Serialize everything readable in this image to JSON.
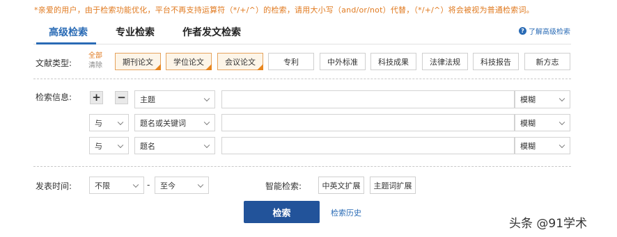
{
  "notice": "*亲爱的用户，由于检索功能优化，平台不再支持运算符（*/+/^）的检索，请用大小写（and/or/not）代替，（*/+/^）将会被视为普通检索词。",
  "tabs": [
    {
      "label": "高级检索",
      "active": true
    },
    {
      "label": "专业检索",
      "active": false
    },
    {
      "label": "作者发文检索",
      "active": false
    }
  ],
  "help": {
    "label": "了解高级检索",
    "icon": "help-circle-icon"
  },
  "doc_type": {
    "label": "文献类型:",
    "all_label": "全部",
    "clear_label": "清除",
    "options": [
      {
        "label": "期刊论文",
        "selected": true
      },
      {
        "label": "学位论文",
        "selected": true
      },
      {
        "label": "会议论文",
        "selected": true
      },
      {
        "label": "专利",
        "selected": false
      },
      {
        "label": "中外标准",
        "selected": false
      },
      {
        "label": "科技成果",
        "selected": false
      },
      {
        "label": "法律法规",
        "selected": false
      },
      {
        "label": "科技报告",
        "selected": false
      },
      {
        "label": "新方志",
        "selected": false
      }
    ]
  },
  "search_info": {
    "label": "检索信息:",
    "add_symbol": "+",
    "remove_symbol": "−",
    "rows": [
      {
        "logic": "",
        "field": "主题",
        "value": "",
        "match": "模糊"
      },
      {
        "logic": "与",
        "field": "题名或关键词",
        "value": "",
        "match": "模糊"
      },
      {
        "logic": "与",
        "field": "题名",
        "value": "",
        "match": "模糊"
      }
    ]
  },
  "publish_time": {
    "label": "发表时间:",
    "from": "不限",
    "separator": "-",
    "to": "至今"
  },
  "smart_search": {
    "label": "智能检索:",
    "options": [
      "中英文扩展",
      "主题词扩展"
    ]
  },
  "search_button": "检索",
  "history_link": "检索历史",
  "watermark": "头条 @91学术",
  "colors": {
    "accent": "#2a6bb5",
    "orange": "#e8861f",
    "button": "#22539a"
  }
}
